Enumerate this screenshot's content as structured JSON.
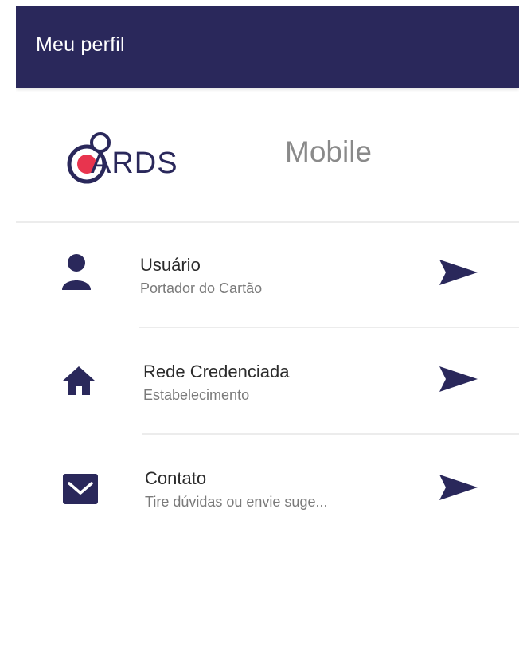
{
  "header": {
    "title": "Meu perfil"
  },
  "brand": {
    "logo_text": "ARDS",
    "subtitle": "Mobile"
  },
  "menu": [
    {
      "title": "Usuário",
      "subtitle": "Portador do Cartão",
      "icon": "person-icon"
    },
    {
      "title": "Rede Credenciada",
      "subtitle": "Estabelecimento",
      "icon": "home-icon"
    },
    {
      "title": "Contato",
      "subtitle": "Tire dúvidas ou envie suge...",
      "icon": "mail-icon"
    }
  ],
  "colors": {
    "primary": "#2a285b",
    "accent": "#e8344e",
    "muted": "#7a7a7a"
  }
}
